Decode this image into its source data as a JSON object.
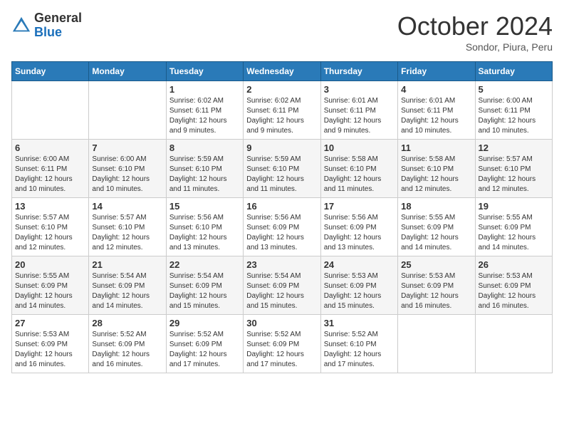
{
  "header": {
    "logo_general": "General",
    "logo_blue": "Blue",
    "month_title": "October 2024",
    "subtitle": "Sondor, Piura, Peru"
  },
  "days_of_week": [
    "Sunday",
    "Monday",
    "Tuesday",
    "Wednesday",
    "Thursday",
    "Friday",
    "Saturday"
  ],
  "weeks": [
    [
      {
        "day": null,
        "sunrise": null,
        "sunset": null,
        "daylight": null
      },
      {
        "day": null,
        "sunrise": null,
        "sunset": null,
        "daylight": null
      },
      {
        "day": "1",
        "sunrise": "Sunrise: 6:02 AM",
        "sunset": "Sunset: 6:11 PM",
        "daylight": "Daylight: 12 hours and 9 minutes."
      },
      {
        "day": "2",
        "sunrise": "Sunrise: 6:02 AM",
        "sunset": "Sunset: 6:11 PM",
        "daylight": "Daylight: 12 hours and 9 minutes."
      },
      {
        "day": "3",
        "sunrise": "Sunrise: 6:01 AM",
        "sunset": "Sunset: 6:11 PM",
        "daylight": "Daylight: 12 hours and 9 minutes."
      },
      {
        "day": "4",
        "sunrise": "Sunrise: 6:01 AM",
        "sunset": "Sunset: 6:11 PM",
        "daylight": "Daylight: 12 hours and 10 minutes."
      },
      {
        "day": "5",
        "sunrise": "Sunrise: 6:00 AM",
        "sunset": "Sunset: 6:11 PM",
        "daylight": "Daylight: 12 hours and 10 minutes."
      }
    ],
    [
      {
        "day": "6",
        "sunrise": "Sunrise: 6:00 AM",
        "sunset": "Sunset: 6:11 PM",
        "daylight": "Daylight: 12 hours and 10 minutes."
      },
      {
        "day": "7",
        "sunrise": "Sunrise: 6:00 AM",
        "sunset": "Sunset: 6:10 PM",
        "daylight": "Daylight: 12 hours and 10 minutes."
      },
      {
        "day": "8",
        "sunrise": "Sunrise: 5:59 AM",
        "sunset": "Sunset: 6:10 PM",
        "daylight": "Daylight: 12 hours and 11 minutes."
      },
      {
        "day": "9",
        "sunrise": "Sunrise: 5:59 AM",
        "sunset": "Sunset: 6:10 PM",
        "daylight": "Daylight: 12 hours and 11 minutes."
      },
      {
        "day": "10",
        "sunrise": "Sunrise: 5:58 AM",
        "sunset": "Sunset: 6:10 PM",
        "daylight": "Daylight: 12 hours and 11 minutes."
      },
      {
        "day": "11",
        "sunrise": "Sunrise: 5:58 AM",
        "sunset": "Sunset: 6:10 PM",
        "daylight": "Daylight: 12 hours and 12 minutes."
      },
      {
        "day": "12",
        "sunrise": "Sunrise: 5:57 AM",
        "sunset": "Sunset: 6:10 PM",
        "daylight": "Daylight: 12 hours and 12 minutes."
      }
    ],
    [
      {
        "day": "13",
        "sunrise": "Sunrise: 5:57 AM",
        "sunset": "Sunset: 6:10 PM",
        "daylight": "Daylight: 12 hours and 12 minutes."
      },
      {
        "day": "14",
        "sunrise": "Sunrise: 5:57 AM",
        "sunset": "Sunset: 6:10 PM",
        "daylight": "Daylight: 12 hours and 12 minutes."
      },
      {
        "day": "15",
        "sunrise": "Sunrise: 5:56 AM",
        "sunset": "Sunset: 6:10 PM",
        "daylight": "Daylight: 12 hours and 13 minutes."
      },
      {
        "day": "16",
        "sunrise": "Sunrise: 5:56 AM",
        "sunset": "Sunset: 6:09 PM",
        "daylight": "Daylight: 12 hours and 13 minutes."
      },
      {
        "day": "17",
        "sunrise": "Sunrise: 5:56 AM",
        "sunset": "Sunset: 6:09 PM",
        "daylight": "Daylight: 12 hours and 13 minutes."
      },
      {
        "day": "18",
        "sunrise": "Sunrise: 5:55 AM",
        "sunset": "Sunset: 6:09 PM",
        "daylight": "Daylight: 12 hours and 14 minutes."
      },
      {
        "day": "19",
        "sunrise": "Sunrise: 5:55 AM",
        "sunset": "Sunset: 6:09 PM",
        "daylight": "Daylight: 12 hours and 14 minutes."
      }
    ],
    [
      {
        "day": "20",
        "sunrise": "Sunrise: 5:55 AM",
        "sunset": "Sunset: 6:09 PM",
        "daylight": "Daylight: 12 hours and 14 minutes."
      },
      {
        "day": "21",
        "sunrise": "Sunrise: 5:54 AM",
        "sunset": "Sunset: 6:09 PM",
        "daylight": "Daylight: 12 hours and 14 minutes."
      },
      {
        "day": "22",
        "sunrise": "Sunrise: 5:54 AM",
        "sunset": "Sunset: 6:09 PM",
        "daylight": "Daylight: 12 hours and 15 minutes."
      },
      {
        "day": "23",
        "sunrise": "Sunrise: 5:54 AM",
        "sunset": "Sunset: 6:09 PM",
        "daylight": "Daylight: 12 hours and 15 minutes."
      },
      {
        "day": "24",
        "sunrise": "Sunrise: 5:53 AM",
        "sunset": "Sunset: 6:09 PM",
        "daylight": "Daylight: 12 hours and 15 minutes."
      },
      {
        "day": "25",
        "sunrise": "Sunrise: 5:53 AM",
        "sunset": "Sunset: 6:09 PM",
        "daylight": "Daylight: 12 hours and 16 minutes."
      },
      {
        "day": "26",
        "sunrise": "Sunrise: 5:53 AM",
        "sunset": "Sunset: 6:09 PM",
        "daylight": "Daylight: 12 hours and 16 minutes."
      }
    ],
    [
      {
        "day": "27",
        "sunrise": "Sunrise: 5:53 AM",
        "sunset": "Sunset: 6:09 PM",
        "daylight": "Daylight: 12 hours and 16 minutes."
      },
      {
        "day": "28",
        "sunrise": "Sunrise: 5:52 AM",
        "sunset": "Sunset: 6:09 PM",
        "daylight": "Daylight: 12 hours and 16 minutes."
      },
      {
        "day": "29",
        "sunrise": "Sunrise: 5:52 AM",
        "sunset": "Sunset: 6:09 PM",
        "daylight": "Daylight: 12 hours and 17 minutes."
      },
      {
        "day": "30",
        "sunrise": "Sunrise: 5:52 AM",
        "sunset": "Sunset: 6:09 PM",
        "daylight": "Daylight: 12 hours and 17 minutes."
      },
      {
        "day": "31",
        "sunrise": "Sunrise: 5:52 AM",
        "sunset": "Sunset: 6:10 PM",
        "daylight": "Daylight: 12 hours and 17 minutes."
      },
      {
        "day": null,
        "sunrise": null,
        "sunset": null,
        "daylight": null
      },
      {
        "day": null,
        "sunrise": null,
        "sunset": null,
        "daylight": null
      }
    ]
  ]
}
